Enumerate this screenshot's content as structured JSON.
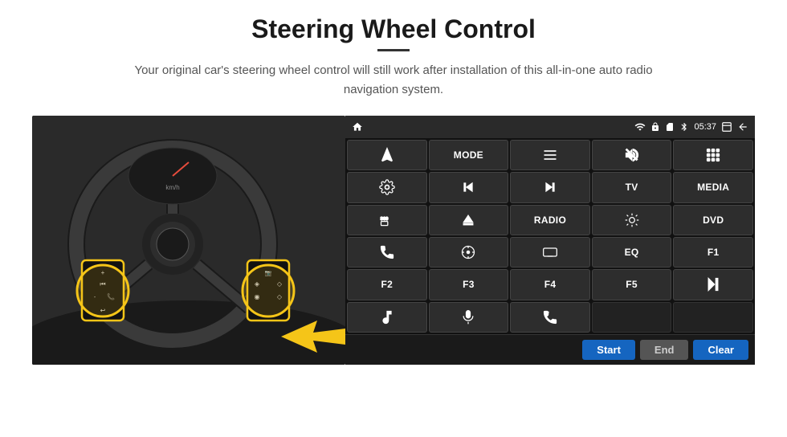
{
  "page": {
    "title": "Steering Wheel Control",
    "subtitle": "Your original car's steering wheel control will still work after installation of this all-in-one auto radio navigation system.",
    "divider_visible": true
  },
  "status_bar": {
    "home_icon": "home",
    "wifi_icon": "wifi",
    "lock_icon": "lock",
    "sim_icon": "sim",
    "bt_icon": "bluetooth",
    "time": "05:37",
    "window_icon": "window",
    "back_icon": "back"
  },
  "buttons": [
    {
      "id": "b1",
      "type": "icon",
      "icon": "navigate",
      "row": 1,
      "col": 1
    },
    {
      "id": "b2",
      "type": "text",
      "label": "MODE",
      "row": 1,
      "col": 2
    },
    {
      "id": "b3",
      "type": "icon",
      "icon": "list",
      "row": 1,
      "col": 3
    },
    {
      "id": "b4",
      "type": "icon",
      "icon": "vol-mute",
      "row": 1,
      "col": 4
    },
    {
      "id": "b5",
      "type": "icon",
      "icon": "apps",
      "row": 1,
      "col": 5
    },
    {
      "id": "b6",
      "type": "icon",
      "icon": "settings",
      "row": 2,
      "col": 1
    },
    {
      "id": "b7",
      "type": "icon",
      "icon": "prev",
      "row": 2,
      "col": 2
    },
    {
      "id": "b8",
      "type": "icon",
      "icon": "next",
      "row": 2,
      "col": 3
    },
    {
      "id": "b9",
      "type": "text",
      "label": "TV",
      "row": 2,
      "col": 4
    },
    {
      "id": "b10",
      "type": "text",
      "label": "MEDIA",
      "row": 2,
      "col": 5
    },
    {
      "id": "b11",
      "type": "icon",
      "icon": "360",
      "row": 3,
      "col": 1
    },
    {
      "id": "b12",
      "type": "icon",
      "icon": "eject",
      "row": 3,
      "col": 2
    },
    {
      "id": "b13",
      "type": "text",
      "label": "RADIO",
      "row": 3,
      "col": 3
    },
    {
      "id": "b14",
      "type": "icon",
      "icon": "brightness",
      "row": 3,
      "col": 4
    },
    {
      "id": "b15",
      "type": "text",
      "label": "DVD",
      "row": 3,
      "col": 5
    },
    {
      "id": "b16",
      "type": "icon",
      "icon": "phone",
      "row": 4,
      "col": 1
    },
    {
      "id": "b17",
      "type": "icon",
      "icon": "nav2",
      "row": 4,
      "col": 2
    },
    {
      "id": "b18",
      "type": "icon",
      "icon": "screen",
      "row": 4,
      "col": 3
    },
    {
      "id": "b19",
      "type": "text",
      "label": "EQ",
      "row": 4,
      "col": 4
    },
    {
      "id": "b20",
      "type": "text",
      "label": "F1",
      "row": 4,
      "col": 5
    },
    {
      "id": "b21",
      "type": "text",
      "label": "F2",
      "row": 5,
      "col": 1
    },
    {
      "id": "b22",
      "type": "text",
      "label": "F3",
      "row": 5,
      "col": 2
    },
    {
      "id": "b23",
      "type": "text",
      "label": "F4",
      "row": 5,
      "col": 3
    },
    {
      "id": "b24",
      "type": "text",
      "label": "F5",
      "row": 5,
      "col": 4
    },
    {
      "id": "b25",
      "type": "icon",
      "icon": "play-pause",
      "row": 5,
      "col": 5
    },
    {
      "id": "b26",
      "type": "icon",
      "icon": "music",
      "row": 6,
      "col": 1
    },
    {
      "id": "b27",
      "type": "icon",
      "icon": "mic",
      "row": 6,
      "col": 2
    },
    {
      "id": "b28",
      "type": "icon",
      "icon": "call",
      "row": 6,
      "col": 3
    }
  ],
  "action_buttons": {
    "start_label": "Start",
    "end_label": "End",
    "clear_label": "Clear"
  },
  "colors": {
    "start_bg": "#1565c0",
    "end_bg": "#666666",
    "clear_bg": "#1565c0",
    "panel_bg": "#1c1c1c",
    "btn_bg": "#2d2d2d"
  }
}
